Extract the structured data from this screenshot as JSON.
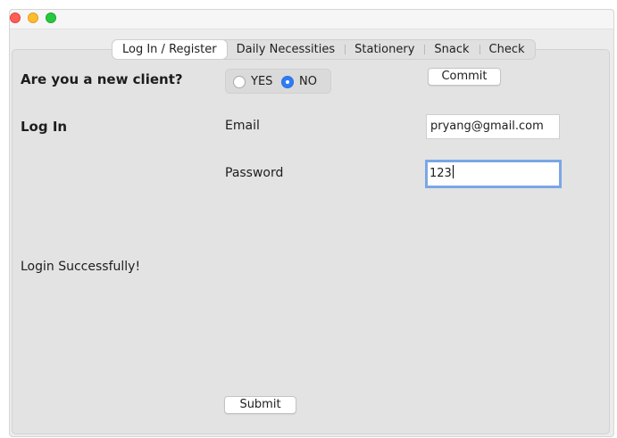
{
  "tabs": [
    {
      "label": "Log In / Register",
      "active": true
    },
    {
      "label": "Daily Necessities",
      "active": false
    },
    {
      "label": "Stationery",
      "active": false
    },
    {
      "label": "Snack",
      "active": false
    },
    {
      "label": "Check",
      "active": false
    }
  ],
  "question": {
    "text": "Are you a new client?",
    "yes_label": "YES",
    "no_label": "NO",
    "selected": "NO"
  },
  "commit_label": "Commit",
  "login": {
    "section_title": "Log In",
    "email_label": "Email",
    "email_value": "pryang@gmail.com",
    "password_label": "Password",
    "password_value": "123"
  },
  "status_message": "Login Successfully!",
  "submit_label": "Submit",
  "colors": {
    "accent": "#2f7cf6",
    "focus_ring": "#7aa7e6",
    "close": "#ff5f57",
    "minimize": "#febc2e",
    "zoom": "#28c840"
  },
  "icons": [
    "close-window-icon",
    "minimize-window-icon",
    "zoom-window-icon"
  ]
}
